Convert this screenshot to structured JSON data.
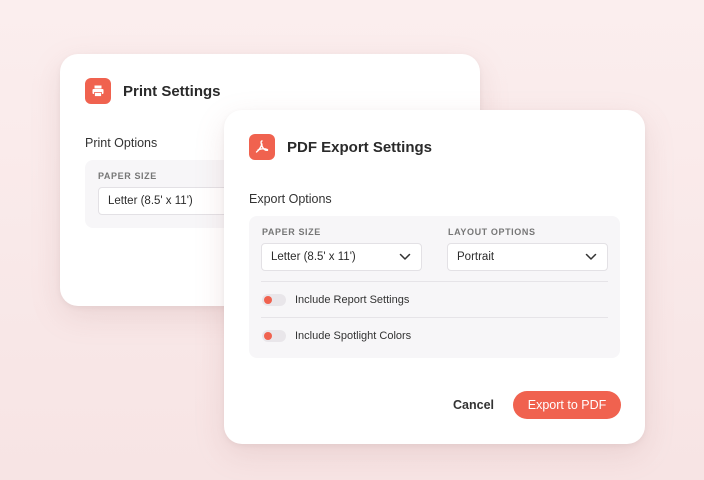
{
  "print_dialog": {
    "title": "Print Settings",
    "icon": "printer-icon",
    "section_title": "Print Options",
    "paper_size_label": "PAPER SIZE",
    "paper_size_value": "Letter (8.5' x 11')"
  },
  "pdf_dialog": {
    "title": "PDF Export Settings",
    "icon": "pdf-icon",
    "section_title": "Export Options",
    "paper_size_label": "PAPER SIZE",
    "paper_size_value": "Letter (8.5' x 11')",
    "layout_label": "LAYOUT OPTIONS",
    "layout_value": "Portrait",
    "toggles": [
      {
        "label": "Include Report Settings"
      },
      {
        "label": "Include Spotlight Colors"
      }
    ],
    "cancel_label": "Cancel",
    "export_label": "Export to PDF"
  },
  "colors": {
    "accent": "#f0624f",
    "background": "#f9e9e9"
  }
}
